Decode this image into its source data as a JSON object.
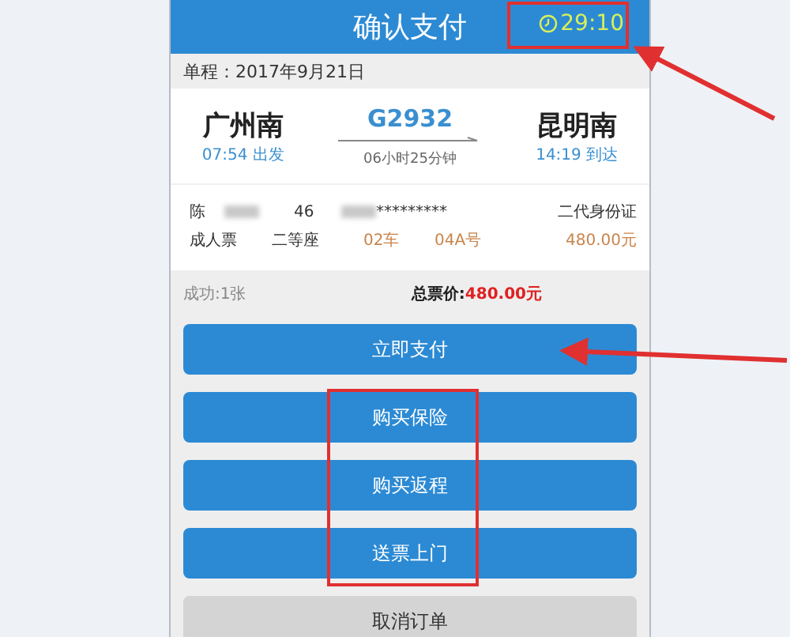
{
  "header": {
    "title": "确认支付",
    "timer": "29:10"
  },
  "trip": {
    "label": "单程：2017年9月21日"
  },
  "train": {
    "from": "广州南",
    "from_time": "07:54 出发",
    "number": "G2932",
    "duration": "06小时25分钟",
    "to": "昆明南",
    "to_time": "14:19 到达"
  },
  "passenger": {
    "name": "陈",
    "id_prefix": "46",
    "id_masked": "*********",
    "id_type": "二代身份证",
    "ticket_type": "成人票",
    "seat_class": "二等座",
    "car": "02车",
    "seat": "04A号",
    "price": "480.00元"
  },
  "summary": {
    "success": "成功:1张",
    "total_label": "总票价:",
    "total": "480.00元"
  },
  "buttons": [
    {
      "label": "立即支付",
      "kind": "primary"
    },
    {
      "label": "购买保险",
      "kind": "primary"
    },
    {
      "label": "购买返程",
      "kind": "primary"
    },
    {
      "label": "送票上门",
      "kind": "primary"
    },
    {
      "label": "取消订单",
      "kind": "secondary"
    }
  ]
}
